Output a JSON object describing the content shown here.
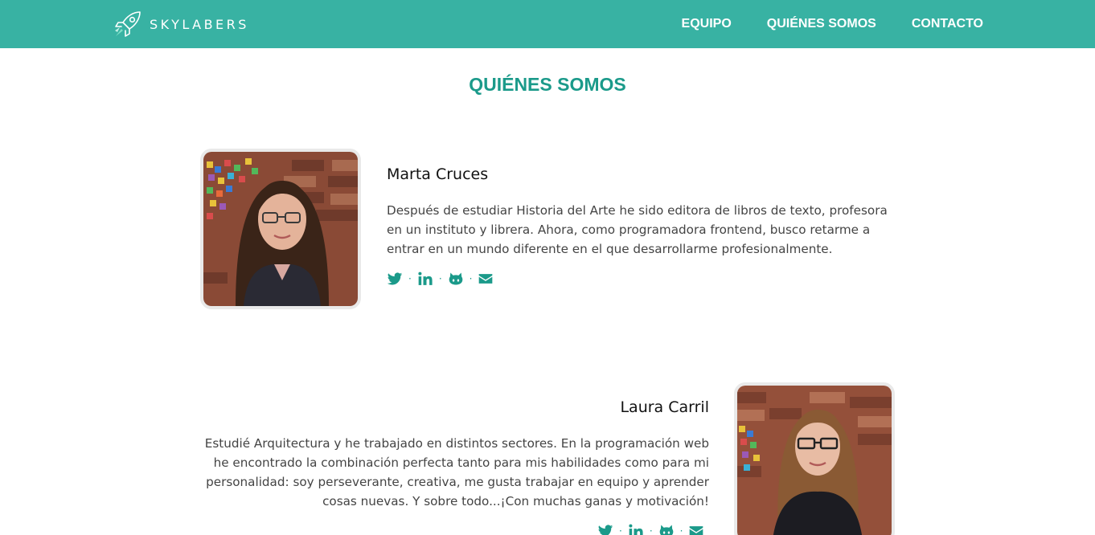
{
  "brand": {
    "name": "SKYLABERS",
    "logo_icon": "rocket-icon"
  },
  "nav": {
    "items": [
      {
        "label": "EQUIPO"
      },
      {
        "label": "QUIÉNES SOMOS"
      },
      {
        "label": "CONTACTO"
      }
    ]
  },
  "colors": {
    "accent": "#38b2a3",
    "accent_dark": "#1b9a8a"
  },
  "page": {
    "title": "QUIÉNES SOMOS"
  },
  "members": [
    {
      "name": "Marta Cruces",
      "bio": "Después de estudiar Historia del Arte he sido editora de libros de texto, profesora en un instituto y librera. Ahora, como programadora frontend, busco retarme a entrar en un mundo diferente en el que desarrollarme profesionalmente.",
      "social": [
        "twitter-icon",
        "linkedin-icon",
        "github-icon",
        "email-icon"
      ],
      "separator": "·"
    },
    {
      "name": "Laura Carril",
      "bio": "Estudié Arquitectura y he trabajado en distintos sectores. En la programación web he encontrado la combinación perfecta tanto para mis habilidades como para mi personalidad: soy perseverante, creativa, me gusta trabajar en equipo y aprender cosas nuevas. Y sobre todo...¡Con muchas ganas y motivación!",
      "social": [
        "twitter-icon",
        "linkedin-icon",
        "github-icon",
        "email-icon"
      ],
      "separator": "·"
    }
  ]
}
